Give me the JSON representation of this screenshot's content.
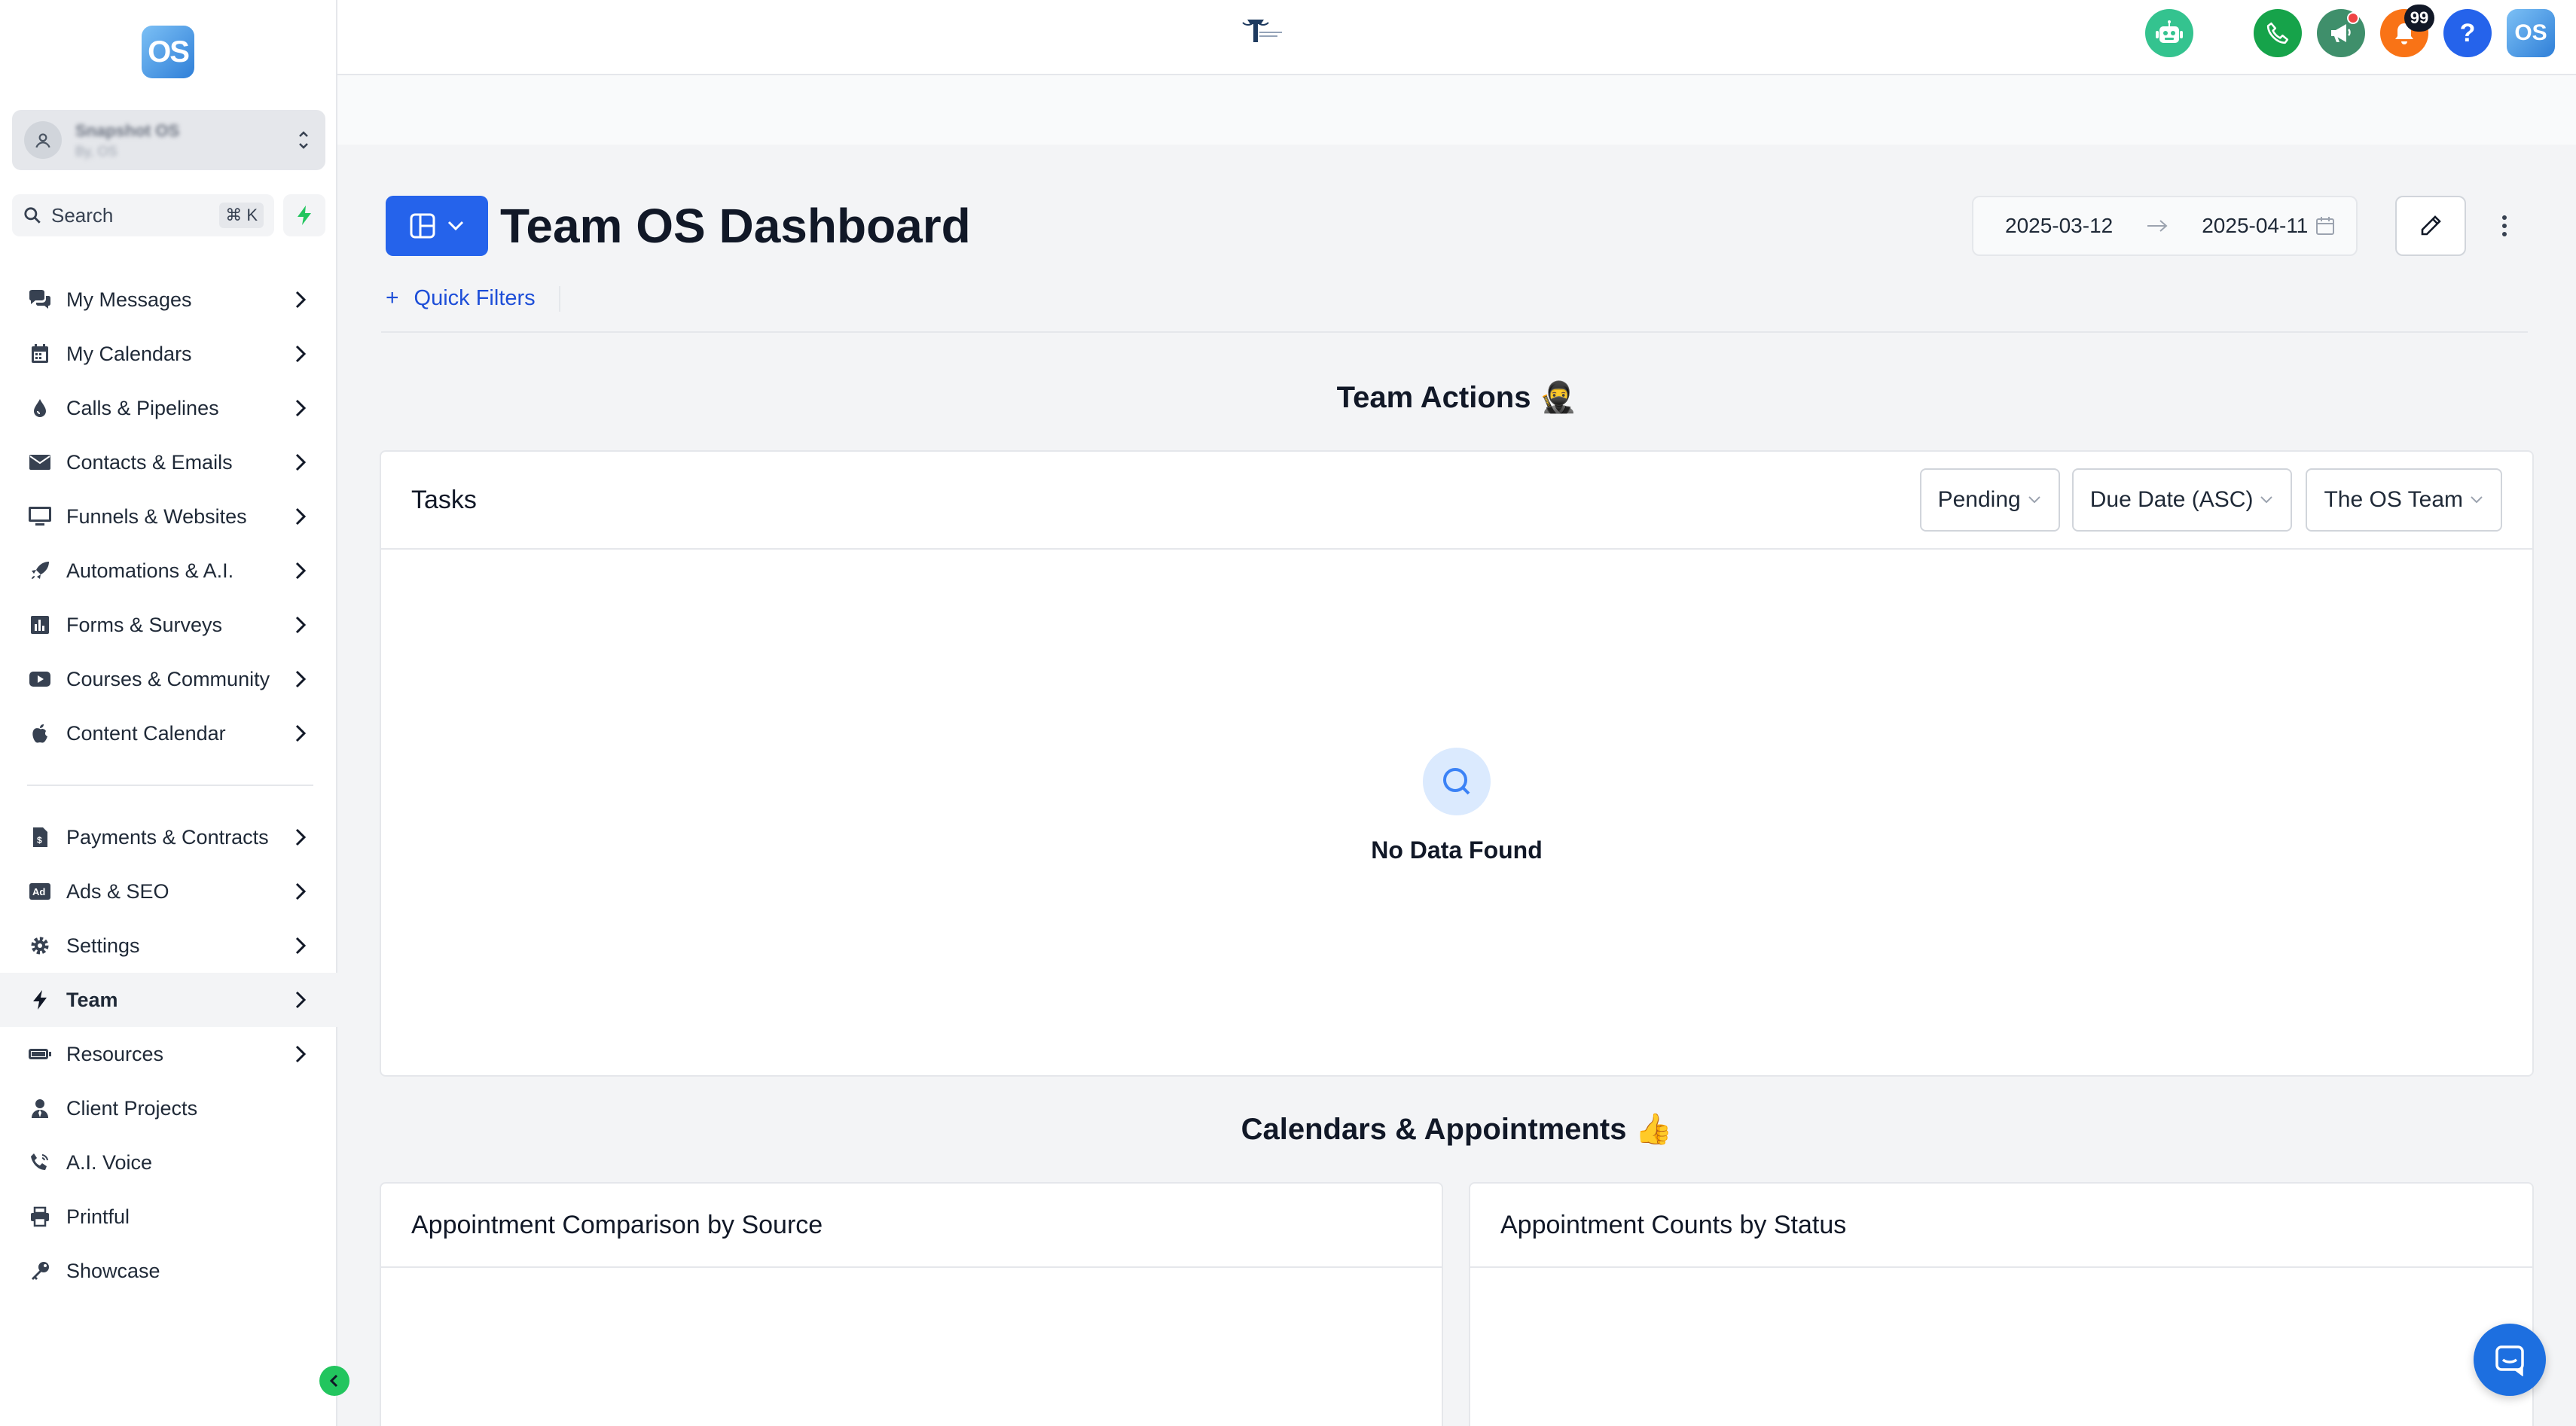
{
  "sidebar": {
    "logo_text": "OS",
    "account": {
      "name": "Snapshot OS",
      "subtitle": "By, OS"
    },
    "search": {
      "label": "Search",
      "shortcut": "⌘ K"
    },
    "items": [
      {
        "label": "My Messages",
        "icon": "chat-bubbles-icon",
        "chevron": true
      },
      {
        "label": "My Calendars",
        "icon": "calendar-icon",
        "chevron": true
      },
      {
        "label": "Calls & Pipelines",
        "icon": "droplet-icon",
        "chevron": true
      },
      {
        "label": "Contacts & Emails",
        "icon": "envelope-icon",
        "chevron": true
      },
      {
        "label": "Funnels & Websites",
        "icon": "monitor-icon",
        "chevron": true
      },
      {
        "label": "Automations & A.I.",
        "icon": "rocket-icon",
        "chevron": true
      },
      {
        "label": "Forms & Surveys",
        "icon": "bar-chart-icon",
        "chevron": true
      },
      {
        "label": "Courses & Community",
        "icon": "youtube-icon",
        "chevron": true
      },
      {
        "label": "Content Calendar",
        "icon": "apple-icon",
        "chevron": true
      }
    ],
    "items2": [
      {
        "label": "Payments & Contracts",
        "icon": "invoice-icon",
        "chevron": true
      },
      {
        "label": "Ads & SEO",
        "icon": "ad-icon",
        "chevron": true
      },
      {
        "label": "Settings",
        "icon": "gear-icon",
        "chevron": true
      },
      {
        "label": "Team",
        "icon": "bolt-icon",
        "chevron": true,
        "active": true
      },
      {
        "label": "Resources",
        "icon": "battery-icon",
        "chevron": true
      },
      {
        "label": "Client Projects",
        "icon": "user-tie-icon",
        "chevron": false
      },
      {
        "label": "A.I. Voice",
        "icon": "phone-volume-icon",
        "chevron": false
      },
      {
        "label": "Printful",
        "icon": "printer-icon",
        "chevron": false
      },
      {
        "label": "Showcase",
        "icon": "key-icon",
        "chevron": false
      }
    ]
  },
  "topbar": {
    "notification_count": "99",
    "help_label": "?",
    "avatar_text": "OS"
  },
  "dashboard": {
    "title": "Team OS Dashboard",
    "date_start": "2025-03-12",
    "date_end": "2025-04-11",
    "quick_filters_label": "Quick Filters"
  },
  "team_actions": {
    "heading": "Team Actions 🥷",
    "tasks_card": {
      "title": "Tasks",
      "filters": {
        "status": "Pending",
        "sort": "Due Date (ASC)",
        "team": "The OS Team"
      },
      "empty_text": "No Data Found"
    }
  },
  "calendars": {
    "heading": "Calendars & Appointments 👍",
    "card_left_title": "Appointment Comparison by Source",
    "card_right_title": "Appointment Counts by Status"
  },
  "colors": {
    "primary": "#2563eb",
    "accent_green": "#22c55e",
    "link": "#1d4ed8",
    "notification_orange": "#f97316"
  }
}
